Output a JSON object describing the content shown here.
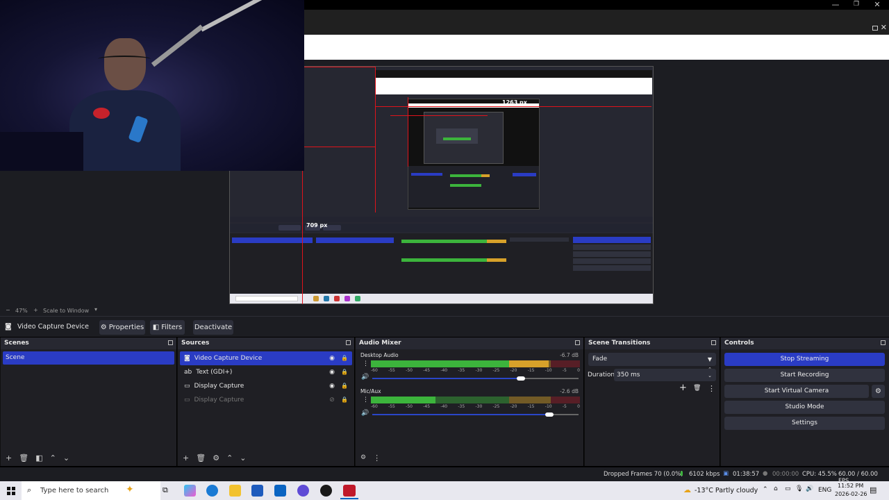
{
  "window": {
    "minimize_glyph": "—",
    "restore_glyph": "❐",
    "close_glyph": "✕"
  },
  "preview": {
    "zoom_label": "47%",
    "scale_label": "Scale to Window",
    "measure_w": "1263 px",
    "measure_h": "709 px"
  },
  "source_toolbar": {
    "current_source": "Video Capture Device",
    "properties": "Properties",
    "filters": "Filters",
    "deactivate": "Deactivate"
  },
  "scenes": {
    "title": "Scenes",
    "items": [
      "Scene"
    ]
  },
  "sources": {
    "title": "Sources",
    "items": [
      {
        "label": "Video Capture Device",
        "icon": "camera-icon",
        "visible": true
      },
      {
        "label": "Text (GDI+)",
        "icon": "text-icon",
        "visible": true
      },
      {
        "label": "Display Capture",
        "icon": "monitor-icon",
        "visible": true
      },
      {
        "label": "Display Capture",
        "icon": "monitor-icon",
        "visible": false
      }
    ]
  },
  "mixer": {
    "title": "Audio Mixer",
    "channels": [
      {
        "name": "Desktop Audio",
        "db": "-6.7 dB",
        "level": 0.85,
        "volume": 0.72
      },
      {
        "name": "Mic/Aux",
        "db": "-2.6 dB",
        "level": 0.31,
        "volume": 0.86
      }
    ],
    "ticks": [
      "-60",
      "-55",
      "-50",
      "-45",
      "-40",
      "-35",
      "-30",
      "-25",
      "-20",
      "-15",
      "-10",
      "-5",
      "0"
    ]
  },
  "transitions": {
    "title": "Scene Transitions",
    "selected": "Fade",
    "duration_label": "Duration",
    "duration_value": "350 ms"
  },
  "controls": {
    "title": "Controls",
    "stop_streaming": "Stop Streaming",
    "start_recording": "Start Recording",
    "start_virtual_camera": "Start Virtual Camera",
    "studio_mode": "Studio Mode",
    "settings": "Settings"
  },
  "statusbar": {
    "dropped": "Dropped Frames 70 (0.0%)",
    "bitrate": "6102 kbps",
    "stream_time": "01:38:57",
    "rec_time": "00:00:00",
    "cpu": "CPU: 45.5%",
    "fps": "60.00 / 60.00 FPS"
  },
  "taskbar": {
    "search_placeholder": "Type here to search",
    "weather": "-13°C  Partly cloudy",
    "lang": "ENG",
    "time": "11:52 PM",
    "date": "2026-02-26"
  },
  "colors": {
    "accent": "#2a3cc4",
    "dock_bg": "#1f1f24",
    "meter_green": "#3cb43c",
    "meter_yellow": "#d7a12a",
    "meter_red": "#9b1c2a"
  }
}
